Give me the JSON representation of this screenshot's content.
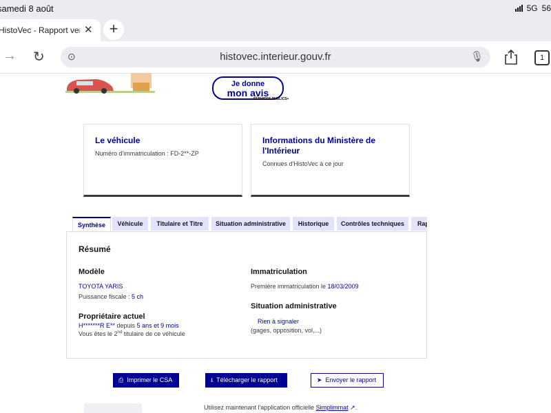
{
  "status_bar": {
    "datetime": "samedi 8 août",
    "network": "5G",
    "battery": "56"
  },
  "browser": {
    "tab_title": "HistoVec - Rapport vendeur",
    "new_tab": "+",
    "url": "histovec.interieur.gouv.fr",
    "tabs_count": "1"
  },
  "banner": {
    "avis_line1": "Je donne",
    "avis_line2": "mon avis",
    "services_publics": "SERVICES PUBLICS+"
  },
  "cards": {
    "vehicle": {
      "title": "Le véhicule",
      "plate_label": "Numéro d'immatriculation : FD-2**-ZP"
    },
    "ministry": {
      "title_line1": "Informations du Ministère de",
      "title_line2": "l'Intérieur",
      "subtitle": "Connues d'HistoVec à ce jour"
    }
  },
  "tabs": [
    "Synthèse",
    "Véhicule",
    "Titulaire et Titre",
    "Situation administrative",
    "Historique",
    "Contrôles techniques",
    "Rapport"
  ],
  "synthese": {
    "heading": "Résumé",
    "model_heading": "Modèle",
    "model_value": "TOYOTA YARIS",
    "puissance_label": "Puissance fiscale : ",
    "puissance_value": "5 ch",
    "owner_heading": "Propriétaire actuel",
    "owner_name": "H*******R E**",
    "owner_since_label": " depuis ",
    "owner_since": "5 ans et 9 mois",
    "titulaire_pre": "Vous êtes le 2",
    "titulaire_sup": "nd",
    "titulaire_post": " titulaire de ce véhicule",
    "immat_heading": "Immatriculation",
    "first_immat_label": "Première immatriculation le ",
    "first_immat_date": "18/03/2009",
    "situation_heading": "Situation administrative",
    "situation_value": "Rien à signaler",
    "situation_note": "(gages, opposition, vol,...)"
  },
  "actions": {
    "print": "Imprimer le CSA",
    "download": "Télécharger le rapport",
    "send": "Envoyer le rapport"
  },
  "footer": {
    "text": "Utilisez maintenant l'application officielle ",
    "link": "Simplimmat",
    "trailing": "."
  },
  "colors": {
    "brand_blue": "#000091",
    "tab_bg": "#e3e3fd"
  }
}
